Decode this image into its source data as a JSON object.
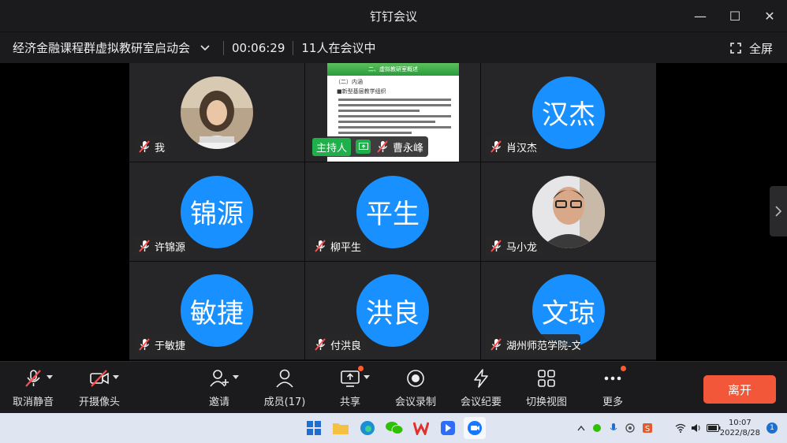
{
  "window": {
    "title": "钉钉会议",
    "minimize": "—",
    "maximize": "☐",
    "close": "✕"
  },
  "meeting": {
    "title": "经济金融课程群虚拟教研室启动会",
    "duration": "00:06:29",
    "count": "11人在会议中",
    "fullscreen": "全屏"
  },
  "participants": [
    {
      "name": "我",
      "type": "photo"
    },
    {
      "name": "曹永峰",
      "type": "screen",
      "host_label": "主持人"
    },
    {
      "name": "肖汉杰",
      "avatar_text": "汉杰",
      "type": "avatar"
    },
    {
      "name": "许锦源",
      "avatar_text": "锦源",
      "type": "avatar"
    },
    {
      "name": "柳平生",
      "avatar_text": "平生",
      "type": "avatar"
    },
    {
      "name": "马小龙",
      "type": "photo"
    },
    {
      "name": "于敏捷",
      "avatar_text": "敏捷",
      "type": "avatar"
    },
    {
      "name": "付洪良",
      "avatar_text": "洪良",
      "type": "avatar"
    },
    {
      "name": "湖州师范学院-文",
      "avatar_text": "文琼",
      "type": "avatar"
    }
  ],
  "slide": {
    "heading": "二、虚拟教研室概述",
    "sub": "（二）内涵",
    "bullet": "■新型基层教学组织"
  },
  "toolbar": {
    "mute": "取消静音",
    "camera": "开摄像头",
    "invite": "邀请",
    "members": "成员(17)",
    "share": "共享",
    "record": "会议录制",
    "minutes": "会议纪要",
    "switch_view": "切换视图",
    "more": "更多",
    "leave": "离开"
  },
  "taskbar": {
    "time": "10:07",
    "date": "2022/8/28",
    "notifications": "1"
  },
  "colors": {
    "avatar": "#1890ff",
    "host": "#20b04b",
    "leave": "#f2573a"
  }
}
